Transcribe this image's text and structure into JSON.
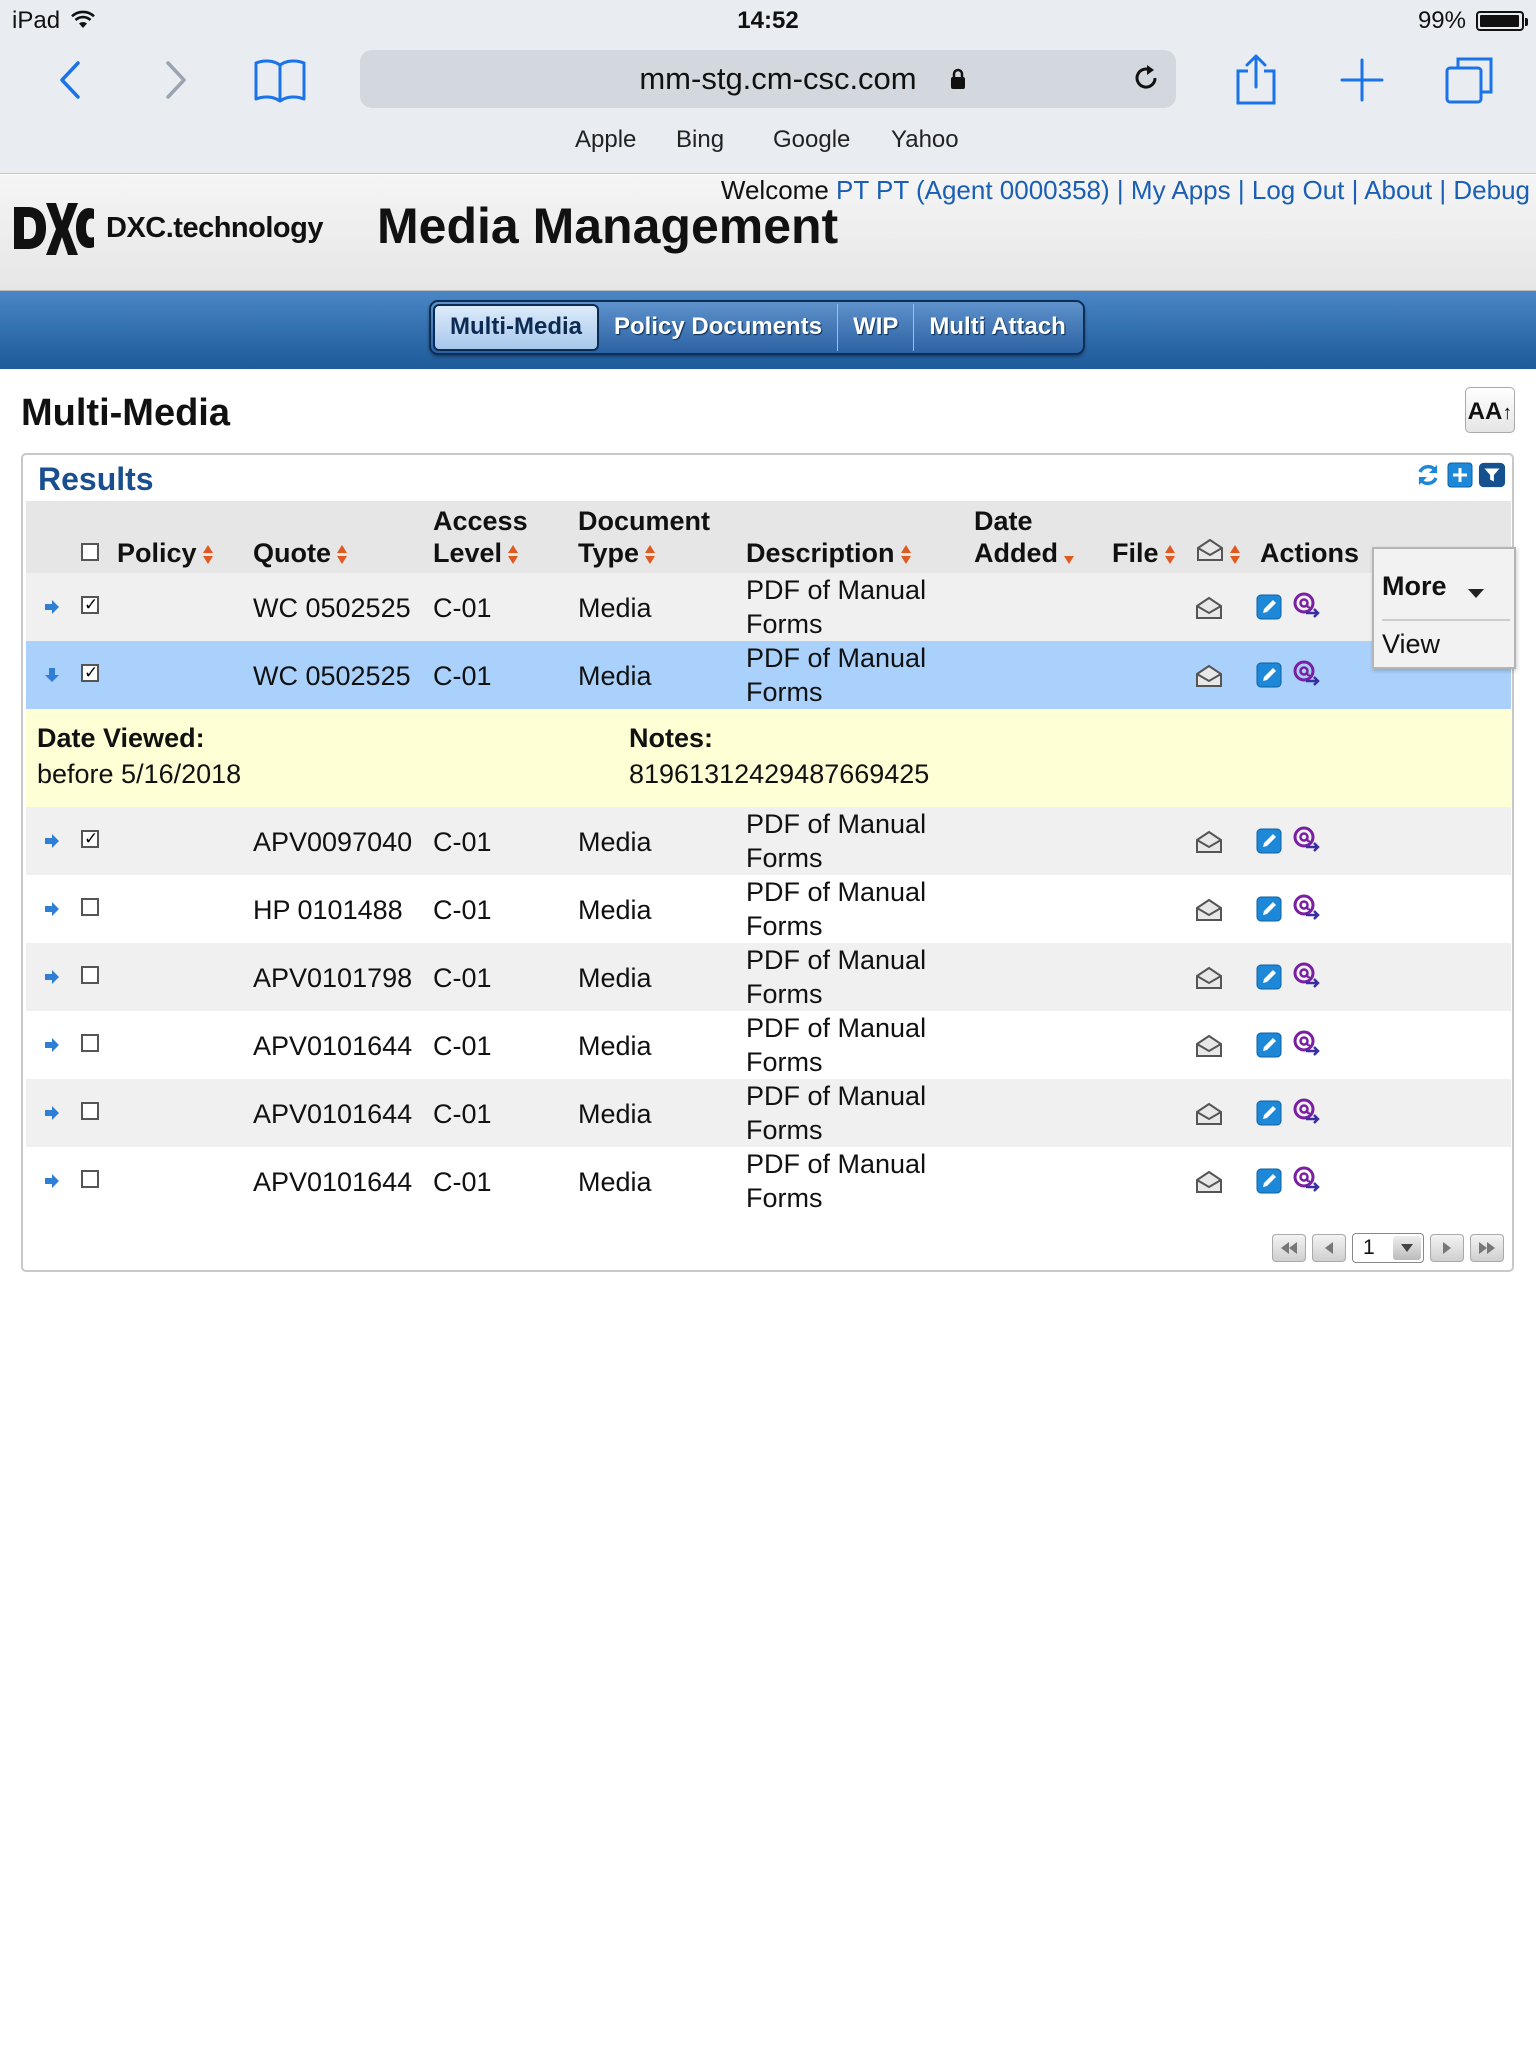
{
  "statusbar": {
    "device": "iPad",
    "time": "14:52",
    "battery": "99%",
    "battery_level": 0.99
  },
  "browser": {
    "url": "mm-stg.cm-csc.com",
    "bookmarks": [
      "Apple",
      "Bing",
      "Google",
      "Yahoo"
    ]
  },
  "header": {
    "welcome_prefix": "Welcome",
    "user_link": "PT PT (Agent 0000358)",
    "links": [
      "My Apps",
      "Log Out",
      "About",
      "Debug"
    ],
    "separator": "|",
    "logo_text": "DXC.technology",
    "app_title": "Media Management"
  },
  "tabs": [
    {
      "label": "Multi-Media",
      "active": true
    },
    {
      "label": "Policy Documents",
      "active": false
    },
    {
      "label": "WIP",
      "active": false
    },
    {
      "label": "Multi Attach",
      "active": false
    }
  ],
  "page": {
    "title": "Multi-Media",
    "font_button": "AA"
  },
  "results": {
    "title": "Results",
    "columns": {
      "policy": "Policy",
      "quote": "Quote",
      "access_level_1": "Access",
      "access_level_2": "Level",
      "doc_type_1": "Document",
      "doc_type_2": "Type",
      "description": "Description",
      "date_added_1": "Date",
      "date_added_2": "Added",
      "file": "File",
      "actions": "Actions"
    },
    "more_menu": {
      "label": "More",
      "items": [
        "View"
      ]
    },
    "rows": [
      {
        "checked": true,
        "quote": "WC 0502525",
        "access": "C-01",
        "type": "Media",
        "desc1": "PDF of Manual",
        "desc2": "Forms",
        "selected": false
      },
      {
        "checked": true,
        "quote": "WC 0502525",
        "access": "C-01",
        "type": "Media",
        "desc1": "PDF of Manual",
        "desc2": "Forms",
        "selected": true
      },
      {
        "checked": true,
        "quote": "APV0097040",
        "access": "C-01",
        "type": "Media",
        "desc1": "PDF of Manual",
        "desc2": "Forms",
        "selected": false
      },
      {
        "checked": false,
        "quote": "HP 0101488",
        "access": "C-01",
        "type": "Media",
        "desc1": "PDF of Manual",
        "desc2": "Forms",
        "selected": false
      },
      {
        "checked": false,
        "quote": "APV0101798",
        "access": "C-01",
        "type": "Media",
        "desc1": "PDF of Manual",
        "desc2": "Forms",
        "selected": false
      },
      {
        "checked": false,
        "quote": "APV0101644",
        "access": "C-01",
        "type": "Media",
        "desc1": "PDF of Manual",
        "desc2": "Forms",
        "selected": false
      },
      {
        "checked": false,
        "quote": "APV0101644",
        "access": "C-01",
        "type": "Media",
        "desc1": "PDF of Manual",
        "desc2": "Forms",
        "selected": false
      },
      {
        "checked": false,
        "quote": "APV0101644",
        "access": "C-01",
        "type": "Media",
        "desc1": "PDF of Manual",
        "desc2": "Forms",
        "selected": false
      }
    ],
    "detail": {
      "date_viewed_label": "Date Viewed:",
      "date_viewed_value": "before 5/16/2018",
      "notes_label": "Notes:",
      "notes_value": "8196131242948766942​5"
    },
    "pager": {
      "page": "1"
    }
  },
  "colors": {
    "accent": "#1a5fb4",
    "nav_blue": "#2b62a3",
    "selected_row": "#a9d1fb",
    "detail_bg": "#ffffd6"
  }
}
